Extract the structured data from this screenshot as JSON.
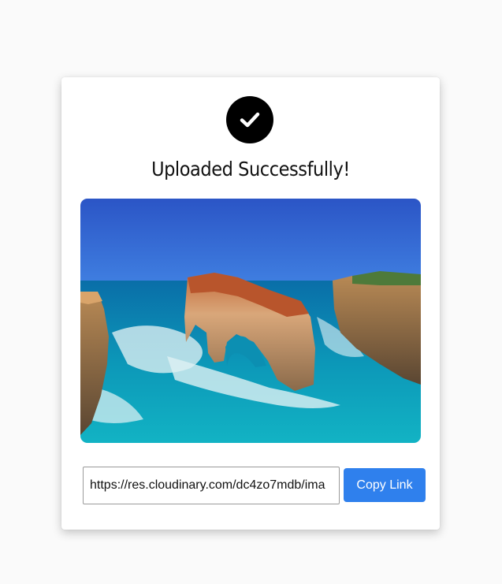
{
  "dialog": {
    "title": "Uploaded Successfully!",
    "icon": "check-icon",
    "image_alt": "Uploaded image preview"
  },
  "link": {
    "value": "https://res.cloudinary.com/dc4zo7mdb/ima",
    "copy_label": "Copy Link"
  },
  "colors": {
    "badge": "#000000",
    "button": "#2f80ed",
    "background": "#fafafa"
  }
}
